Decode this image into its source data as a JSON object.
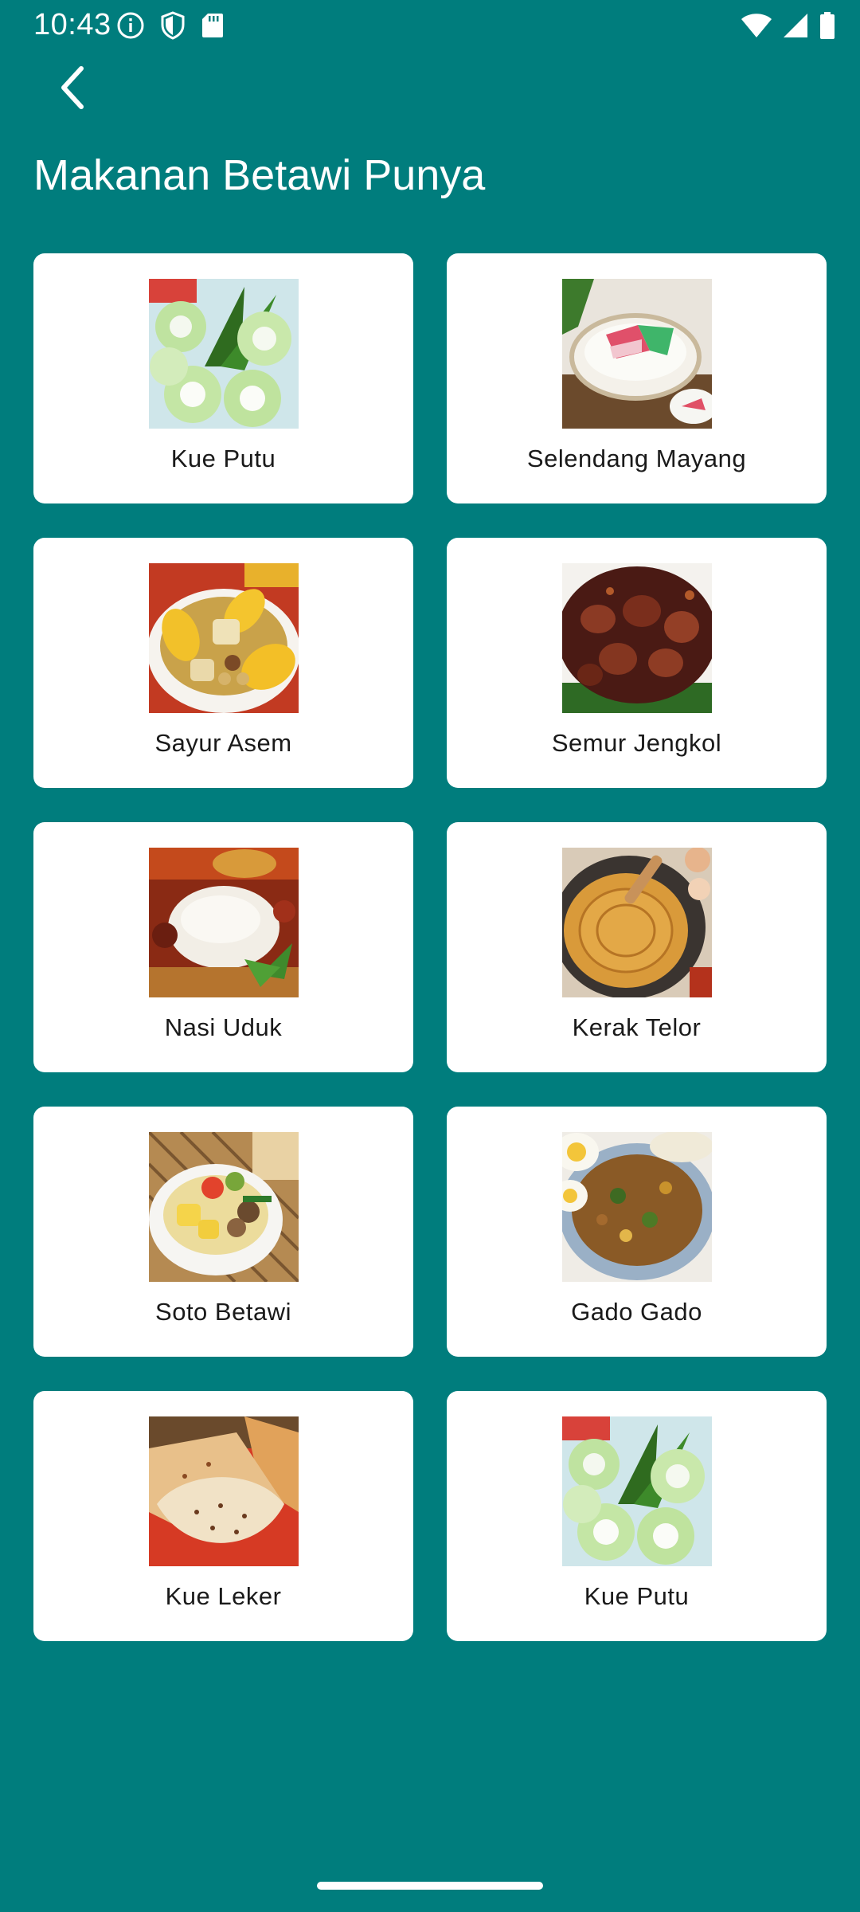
{
  "status_bar": {
    "time": "10:43",
    "left_icons": [
      "info-icon",
      "shield-icon",
      "sd-card-icon"
    ],
    "right_icons": [
      "wifi-icon",
      "signal-icon",
      "battery-icon"
    ]
  },
  "header": {
    "back_icon": "chevron-left-icon",
    "title": "Makanan Betawi Punya"
  },
  "foods": [
    {
      "label": "Kue Putu",
      "image": "kue-putu"
    },
    {
      "label": "Selendang Mayang",
      "image": "selendang-mayang"
    },
    {
      "label": "Sayur Asem",
      "image": "sayur-asem"
    },
    {
      "label": "Semur Jengkol",
      "image": "semur-jengkol"
    },
    {
      "label": "Nasi Uduk",
      "image": "nasi-uduk"
    },
    {
      "label": "Kerak Telor",
      "image": "kerak-telor"
    },
    {
      "label": "Soto Betawi",
      "image": "soto-betawi"
    },
    {
      "label": "Gado Gado",
      "image": "gado-gado"
    },
    {
      "label": "Kue Leker",
      "image": "kue-leker"
    },
    {
      "label": "Kue Putu",
      "image": "kue-putu"
    }
  ],
  "colors": {
    "background": "#007d7d",
    "card": "#ffffff",
    "label_text": "#1a1a1a"
  }
}
